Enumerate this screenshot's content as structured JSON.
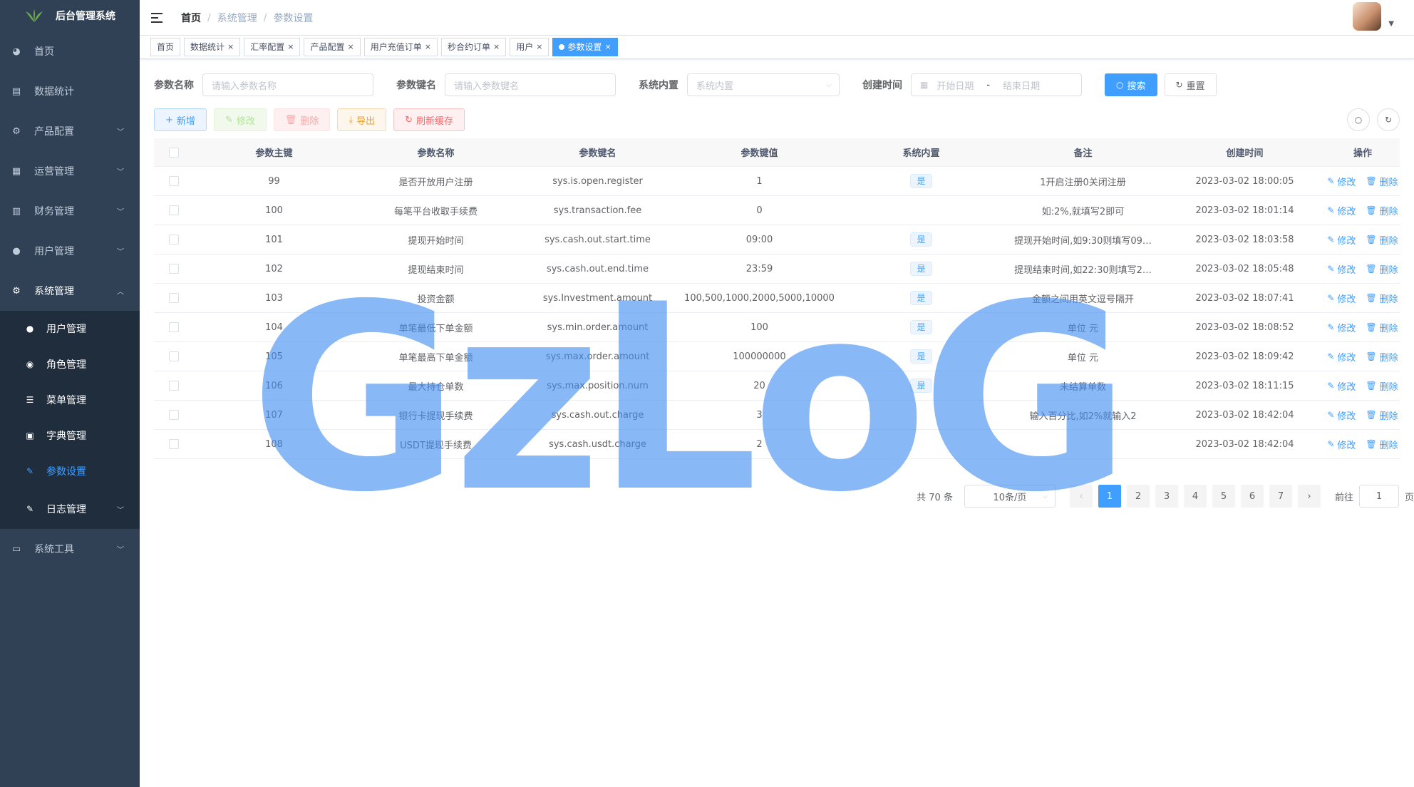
{
  "app": {
    "title": "后台管理系统"
  },
  "sidebar": {
    "items": [
      {
        "label": "首页",
        "icon": "dashboard-icon",
        "glyph": "◕"
      },
      {
        "label": "数据统计",
        "icon": "chart-icon",
        "glyph": "▤"
      },
      {
        "label": "产品配置",
        "icon": "gear-icon",
        "glyph": "⚙"
      },
      {
        "label": "运营管理",
        "icon": "grid-icon",
        "glyph": "▦"
      },
      {
        "label": "财务管理",
        "icon": "book-icon",
        "glyph": "▥"
      },
      {
        "label": "用户管理",
        "icon": "user-icon",
        "glyph": "●"
      },
      {
        "label": "系统管理",
        "icon": "gear-icon",
        "glyph": "⚙"
      }
    ],
    "submenu": [
      {
        "label": "用户管理",
        "icon": "user-icon",
        "glyph": "●"
      },
      {
        "label": "角色管理",
        "icon": "role-icon",
        "glyph": "◉"
      },
      {
        "label": "菜单管理",
        "icon": "tree-icon",
        "glyph": "☰"
      },
      {
        "label": "字典管理",
        "icon": "dict-icon",
        "glyph": "▣"
      },
      {
        "label": "参数设置",
        "icon": "edit-icon",
        "glyph": "✎"
      },
      {
        "label": "日志管理",
        "icon": "log-icon",
        "glyph": "✎"
      }
    ],
    "tools": {
      "label": "系统工具",
      "icon": "toolbox-icon",
      "glyph": "▭"
    }
  },
  "breadcrumb": {
    "home": "首页",
    "level1": "系统管理",
    "current": "参数设置",
    "sep": "/"
  },
  "tags": [
    {
      "label": "首页",
      "closable": false
    },
    {
      "label": "数据统计",
      "closable": true
    },
    {
      "label": "汇率配置",
      "closable": true
    },
    {
      "label": "产品配置",
      "closable": true
    },
    {
      "label": "用户充值订单",
      "closable": true
    },
    {
      "label": "秒合约订单",
      "closable": true
    },
    {
      "label": "用户",
      "closable": true
    },
    {
      "label": "参数设置",
      "closable": true,
      "active": true
    }
  ],
  "search": {
    "name_label": "参数名称",
    "name_placeholder": "请输入参数名称",
    "key_label": "参数键名",
    "key_placeholder": "请输入参数键名",
    "type_label": "系统内置",
    "type_placeholder": "系统内置",
    "time_label": "创建时间",
    "start_placeholder": "开始日期",
    "range_sep": "-",
    "end_placeholder": "结束日期",
    "search_btn": "搜索",
    "reset_btn": "重置"
  },
  "toolbar": {
    "add": "新增",
    "edit": "修改",
    "delete": "删除",
    "export": "导出",
    "refresh": "刷新缓存"
  },
  "table": {
    "columns": [
      "参数主键",
      "参数名称",
      "参数键名",
      "参数键值",
      "系统内置",
      "备注",
      "创建时间",
      "操作"
    ],
    "edit_label": "修改",
    "delete_label": "删除",
    "rows": [
      {
        "id": "99",
        "name": "是否开放用户注册",
        "key": "sys.is.open.register",
        "value": "1",
        "sys": "是",
        "remark": "1开启注册0关闭注册",
        "time": "2023-03-02 18:00:05"
      },
      {
        "id": "100",
        "name": "每笔平台收取手续费",
        "key": "sys.transaction.fee",
        "value": "0",
        "sys": "",
        "remark": "如:2%,就填写2即可",
        "time": "2023-03-02 18:01:14"
      },
      {
        "id": "101",
        "name": "提现开始时间",
        "key": "sys.cash.out.start.time",
        "value": "09:00",
        "sys": "是",
        "remark": "提现开始时间,如9:30则填写09…",
        "time": "2023-03-02 18:03:58"
      },
      {
        "id": "102",
        "name": "提现结束时间",
        "key": "sys.cash.out.end.time",
        "value": "23:59",
        "sys": "是",
        "remark": "提现结束时间,如22:30则填写2…",
        "time": "2023-03-02 18:05:48"
      },
      {
        "id": "103",
        "name": "投资金额",
        "key": "sys.Investment.amount",
        "value": "100,500,1000,2000,5000,10000",
        "sys": "是",
        "remark": "金额之间用英文逗号隔开",
        "time": "2023-03-02 18:07:41"
      },
      {
        "id": "104",
        "name": "单笔最低下单金额",
        "key": "sys.min.order.amount",
        "value": "100",
        "sys": "是",
        "remark": "单位 元",
        "time": "2023-03-02 18:08:52"
      },
      {
        "id": "105",
        "name": "单笔最高下单金额",
        "key": "sys.max.order.amount",
        "value": "100000000",
        "sys": "是",
        "remark": "单位 元",
        "time": "2023-03-02 18:09:42"
      },
      {
        "id": "106",
        "name": "最大持仓单数",
        "key": "sys.max.position.num",
        "value": "20",
        "sys": "是",
        "remark": "未结算单数",
        "time": "2023-03-02 18:11:15"
      },
      {
        "id": "107",
        "name": "银行卡提现手续费",
        "key": "sys.cash.out.charge",
        "value": "3",
        "sys": "",
        "remark": "输入百分比,如2%就输入2",
        "time": "2023-03-02 18:42:04"
      },
      {
        "id": "108",
        "name": "USDT提现手续费",
        "key": "sys.cash.usdt.charge",
        "value": "2",
        "sys": "",
        "remark": "",
        "time": "2023-03-02 18:42:04"
      }
    ]
  },
  "pagination": {
    "total": "共 70 条",
    "page_size": "10条/页",
    "pages": [
      "1",
      "2",
      "3",
      "4",
      "5",
      "6",
      "7"
    ],
    "current_page": "1",
    "goto_label": "前往",
    "goto_value": "1",
    "page_suffix": "页"
  },
  "watermark": {
    "text": "GzLoG"
  },
  "colors": {
    "sidebar": "#304156",
    "submenu": "#1f2d3d",
    "primary": "#409eff",
    "watermark": "#408cf0"
  }
}
